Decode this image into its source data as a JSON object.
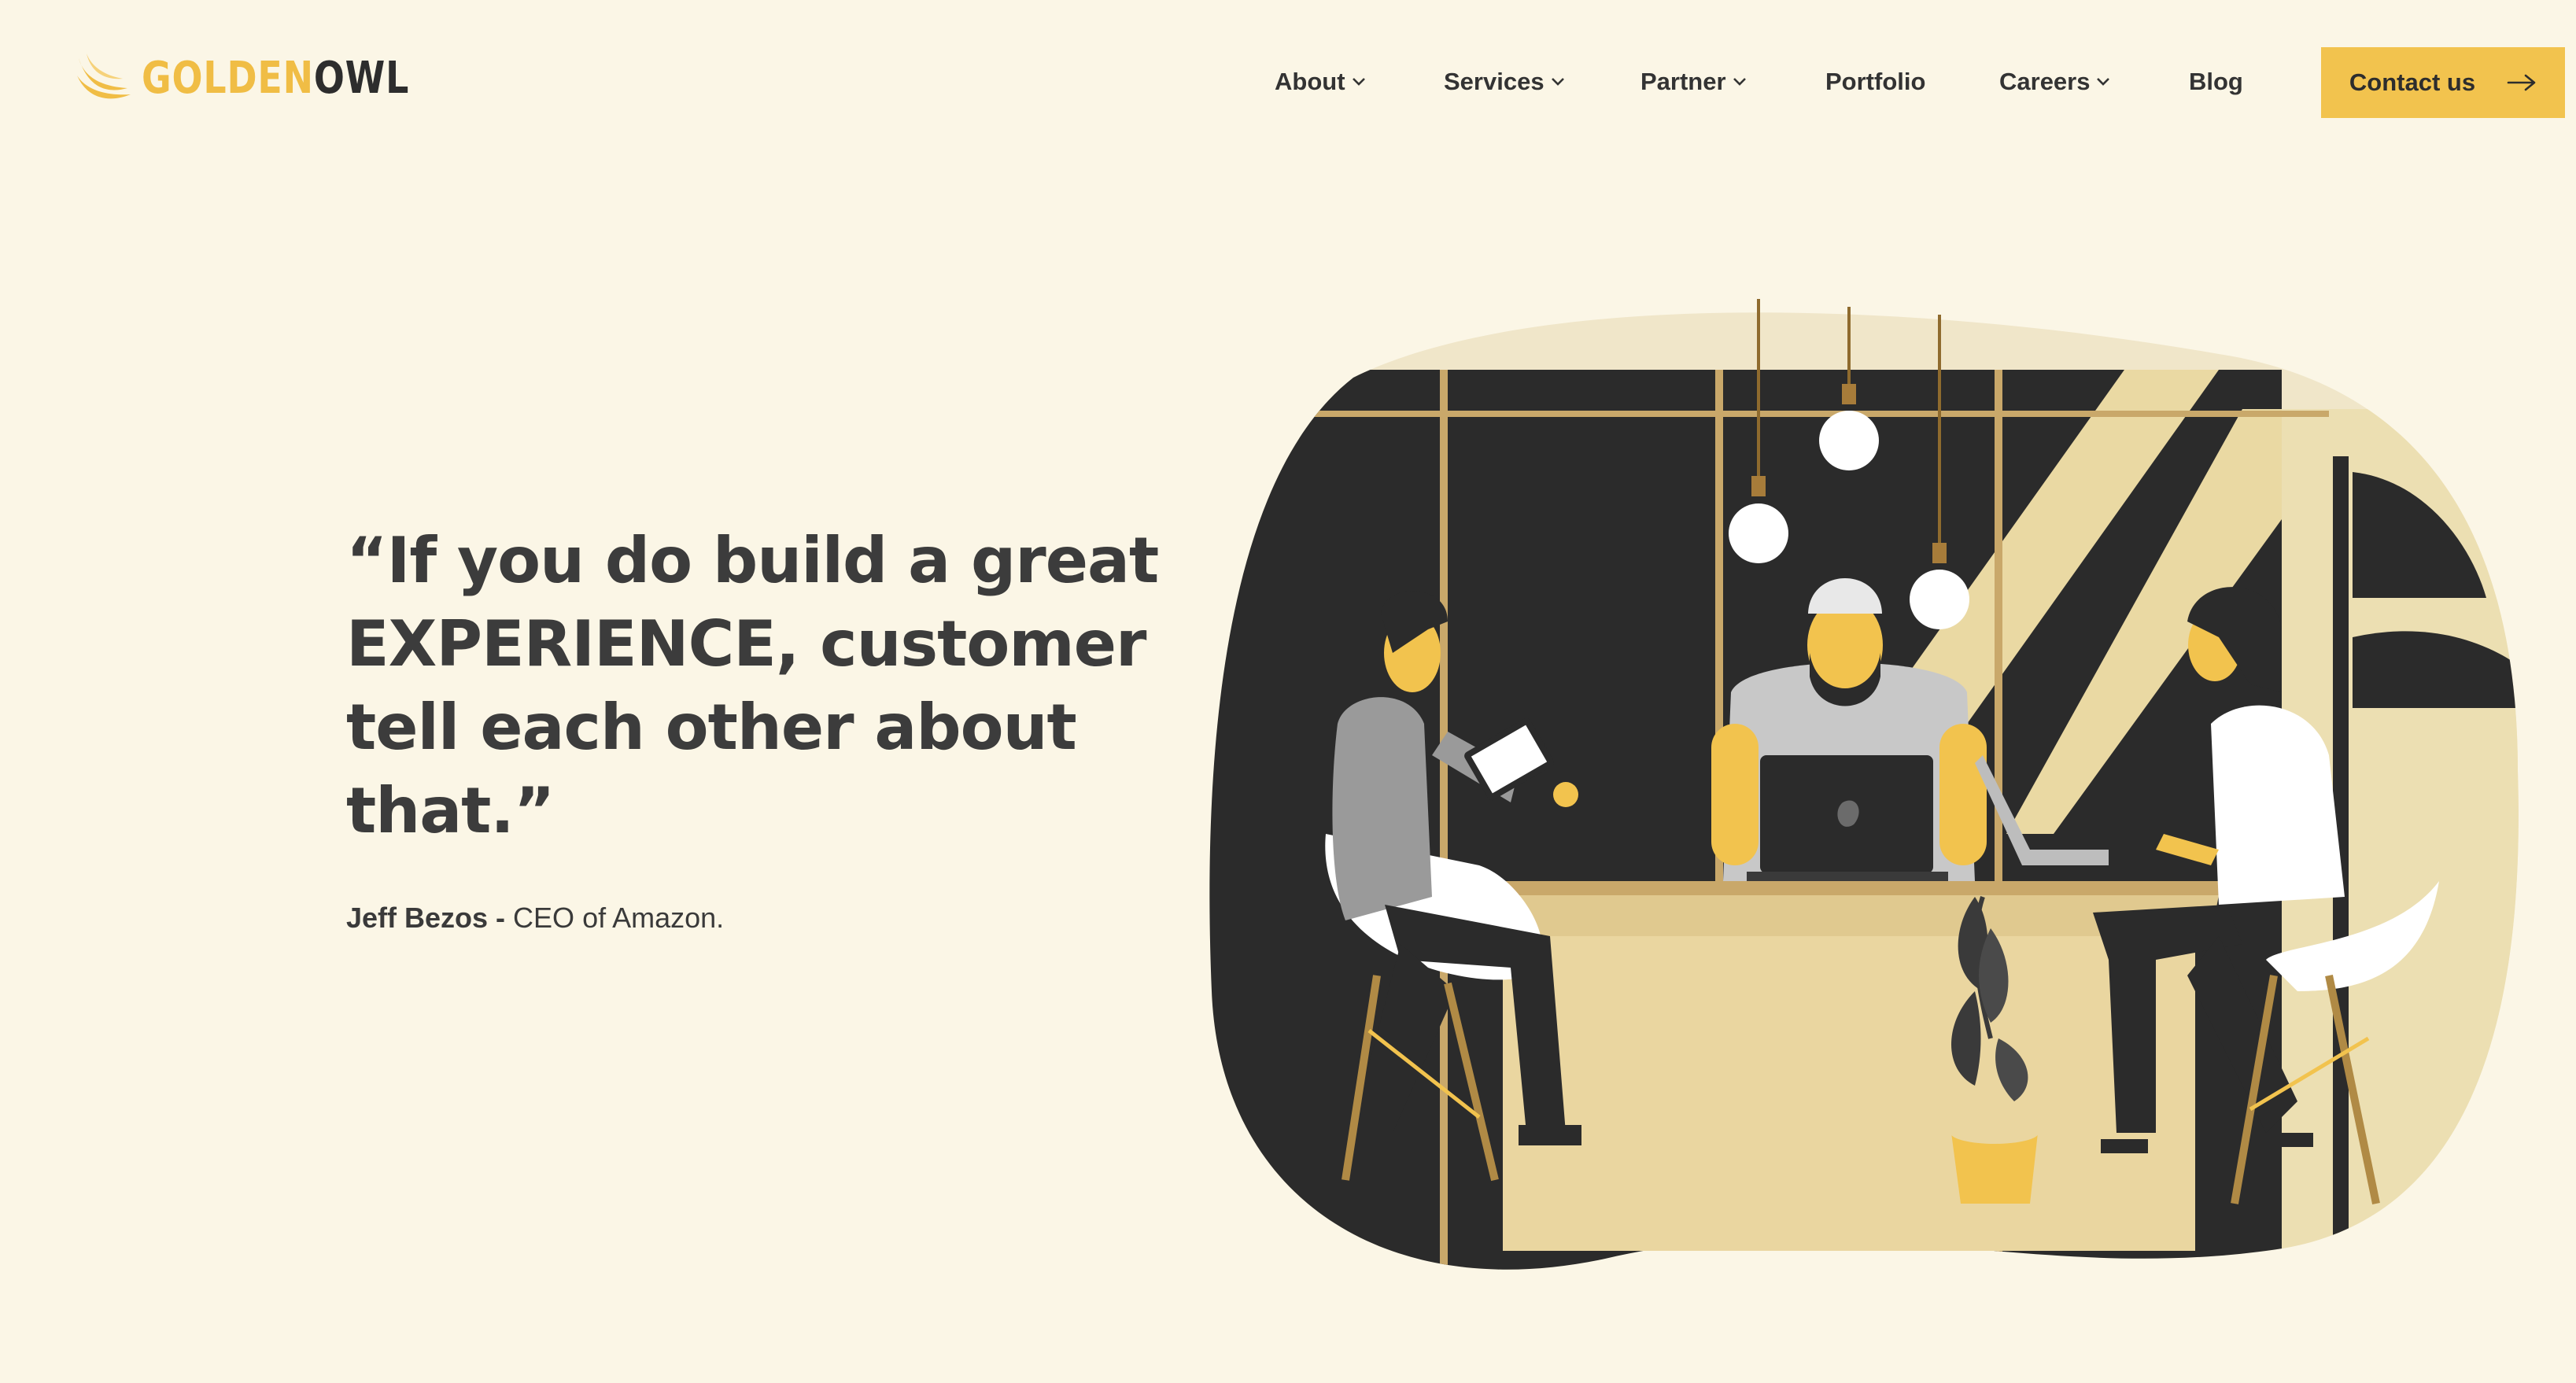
{
  "brand": {
    "name_part1": "GOLDEN",
    "name_part2": "OWL",
    "gold": "#f0bd45",
    "dark": "#2d2d2d"
  },
  "nav": {
    "items": [
      {
        "label": "About",
        "has_dropdown": true
      },
      {
        "label": "Services",
        "has_dropdown": true
      },
      {
        "label": "Partner",
        "has_dropdown": true
      },
      {
        "label": "Portfolio",
        "has_dropdown": false
      },
      {
        "label": "Careers",
        "has_dropdown": true
      },
      {
        "label": "Blog",
        "has_dropdown": false
      }
    ],
    "cta": {
      "label": "Contact us",
      "icon": "arrow-right-icon"
    }
  },
  "hero": {
    "quote_line1": "“If you do build a great",
    "quote_line2": "EXPERIENCE, customer",
    "quote_line3": "tell each other about",
    "quote_line4": "that.”",
    "author_name": "Jeff Bezos -",
    "author_title": " CEO of Amazon."
  },
  "illustration": {
    "subject": "three people working at a shared table with laptops under hanging bulbs",
    "colors": {
      "accent": "#f2c34e",
      "dark": "#2b2b2b",
      "light": "#f0e6c9",
      "page": "#fbf6e6"
    }
  }
}
